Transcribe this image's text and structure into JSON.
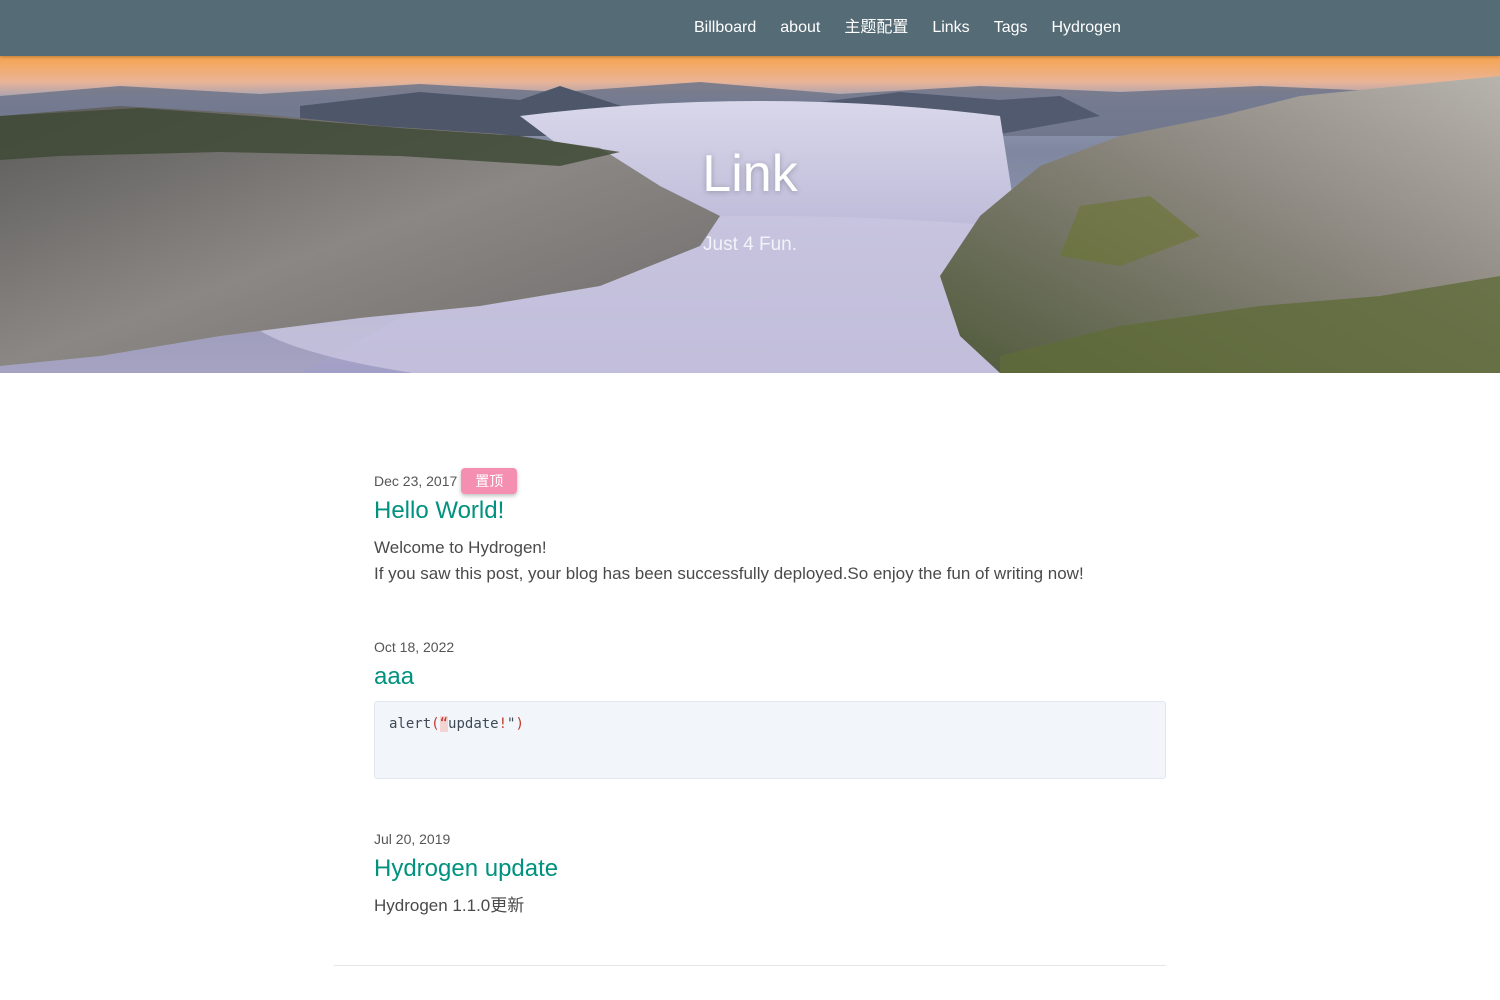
{
  "nav": {
    "items": [
      {
        "label": "Billboard"
      },
      {
        "label": "about"
      },
      {
        "label": "主题配置"
      },
      {
        "label": "Links"
      },
      {
        "label": "Tags"
      },
      {
        "label": "Hydrogen"
      }
    ],
    "background": "#556b76"
  },
  "hero": {
    "title": "Link",
    "subtitle": "Just 4 Fun."
  },
  "posts": [
    {
      "date": "Dec 23, 2017",
      "badge": "置顶",
      "title": "Hello World!",
      "excerpt": [
        "Welcome to Hydrogen!",
        "If you saw this post, your blog has been successfully deployed.So enjoy the fun of writing now!"
      ]
    },
    {
      "date": "Oct 18, 2022",
      "title": "aaa",
      "code": {
        "fn": "alert",
        "open": "(",
        "quote_open": "“",
        "text": "update",
        "bang": "!",
        "quote_close": "\"",
        "close": ")"
      }
    },
    {
      "date": "Jul 20, 2019",
      "title": "Hydrogen update",
      "excerpt": [
        "Hydrogen 1.1.0更新"
      ]
    }
  ],
  "colors": {
    "accent": "#00927e",
    "badge": "#f48fb1",
    "code_bg": "#f2f5fa"
  }
}
